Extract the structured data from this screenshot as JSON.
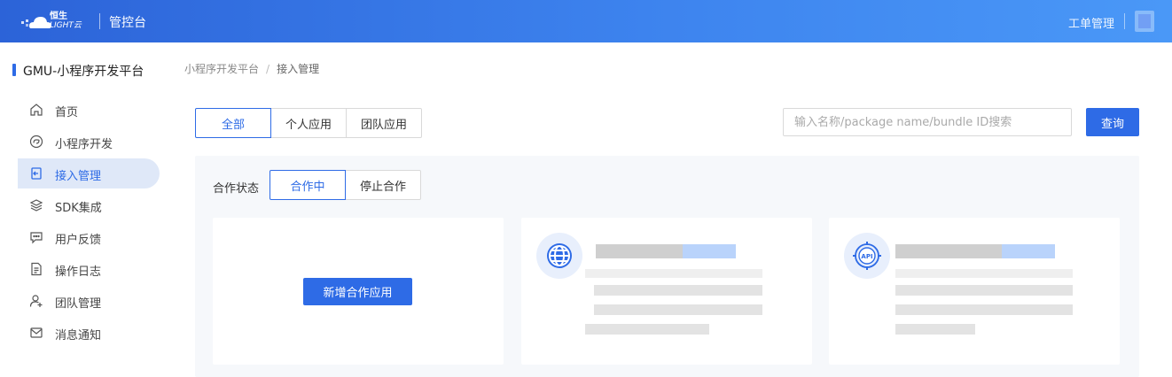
{
  "header": {
    "logo_line1": "恒生",
    "logo_line2": "LIGHT云",
    "title": "管控台",
    "ticket_link": "工单管理"
  },
  "sidebar": {
    "platform_title": "GMU-小程序开发平台",
    "items": [
      {
        "label": "首页",
        "icon": "home-icon",
        "active": false
      },
      {
        "label": "小程序开发",
        "icon": "miniapp-icon",
        "active": false
      },
      {
        "label": "接入管理",
        "icon": "access-icon",
        "active": true
      },
      {
        "label": "SDK集成",
        "icon": "layers-icon",
        "active": false
      },
      {
        "label": "用户反馈",
        "icon": "feedback-icon",
        "active": false
      },
      {
        "label": "操作日志",
        "icon": "document-icon",
        "active": false
      },
      {
        "label": "团队管理",
        "icon": "team-icon",
        "active": false
      },
      {
        "label": "消息通知",
        "icon": "mail-icon",
        "active": false
      }
    ]
  },
  "breadcrumb": {
    "parent": "小程序开发平台",
    "separator": "/",
    "current": "接入管理"
  },
  "filters": {
    "app_type_tabs": [
      {
        "label": "全部",
        "active": true
      },
      {
        "label": "个人应用",
        "active": false
      },
      {
        "label": "团队应用",
        "active": false
      }
    ],
    "search_placeholder": "输入名称/package name/bundle ID搜索",
    "query_label": "查询"
  },
  "panel": {
    "status_label": "合作状态",
    "status_tabs": [
      {
        "label": "合作中",
        "active": true
      },
      {
        "label": "停止合作",
        "active": false
      }
    ],
    "add_button_label": "新增合作应用",
    "cards": [
      {
        "icon": "globe-icon"
      },
      {
        "icon": "api-icon"
      }
    ]
  },
  "colors": {
    "primary": "#2e6be6",
    "header_start": "#2c63d8",
    "header_end": "#4a98f7",
    "panel_bg": "#f6f8fb"
  }
}
